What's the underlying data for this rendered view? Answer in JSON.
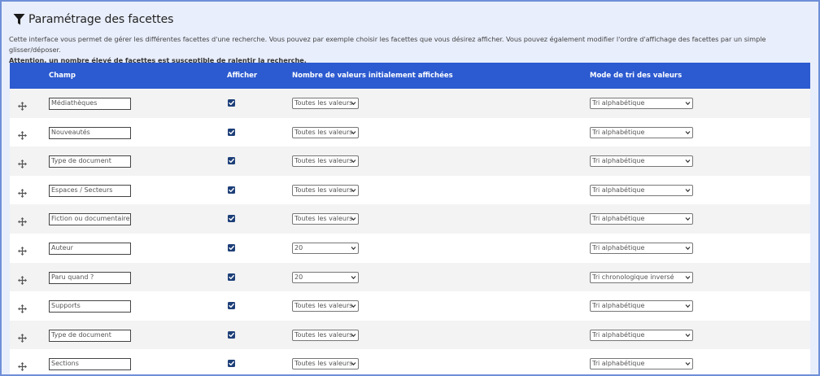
{
  "header": {
    "title": "Paramétrage des facettes",
    "icon": "filter-icon"
  },
  "description": {
    "text": "Cette interface vous permet de gérer les différentes facettes d'une recherche. Vous pouvez par exemple choisir les facettes que vous désirez afficher. Vous pouvez également modifier l'ordre d'affichage des facettes par un simple glisser/déposer.",
    "warning": "Attention, un nombre élevé de facettes est susceptible de ralentir la recherche."
  },
  "colors": {
    "header_bg": "#2c5ad0",
    "frame_border": "#6f8fd8",
    "frame_bg": "#e8eefb",
    "checkbox": "#1d3f78"
  },
  "table": {
    "columns": {
      "champ": "Champ",
      "afficher": "Afficher",
      "count": "Nombre de valeurs initialement affichées",
      "sort": "Mode de tri des valeurs"
    },
    "rows": [
      {
        "field": "Médiathèques",
        "checked": true,
        "count": "Toutes les valeurs",
        "sort": "Tri alphabétique"
      },
      {
        "field": "Nouveautés",
        "checked": true,
        "count": "Toutes les valeurs",
        "sort": "Tri alphabétique"
      },
      {
        "field": "Type de document",
        "checked": true,
        "count": "Toutes les valeurs",
        "sort": "Tri alphabétique"
      },
      {
        "field": "Espaces / Secteurs",
        "checked": true,
        "count": "Toutes les valeurs",
        "sort": "Tri alphabétique"
      },
      {
        "field": "Fiction ou documentaire",
        "checked": true,
        "count": "Toutes les valeurs",
        "sort": "Tri alphabétique"
      },
      {
        "field": "Auteur",
        "checked": true,
        "count": "20",
        "sort": "Tri alphabétique"
      },
      {
        "field": "Paru quand ?",
        "checked": true,
        "count": "20",
        "sort": "Tri chronologique inversé"
      },
      {
        "field": "Supports",
        "checked": true,
        "count": "Toutes les valeurs",
        "sort": "Tri alphabétique"
      },
      {
        "field": "Type de document",
        "checked": true,
        "count": "Toutes les valeurs",
        "sort": "Tri alphabétique"
      },
      {
        "field": "Sections",
        "checked": true,
        "count": "Toutes les valeurs",
        "sort": "Tri alphabétique"
      }
    ]
  }
}
